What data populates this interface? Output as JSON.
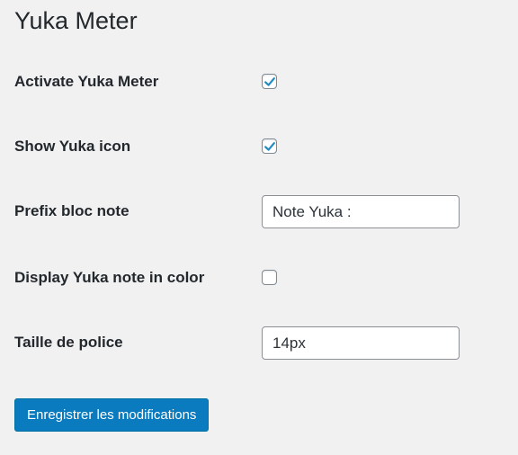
{
  "page": {
    "title": "Yuka Meter"
  },
  "settings": [
    {
      "label": "Activate Yuka Meter",
      "type": "checkbox",
      "checked": true
    },
    {
      "label": "Show Yuka icon",
      "type": "checkbox",
      "checked": true
    },
    {
      "label": "Prefix bloc note",
      "type": "text",
      "value": "Note Yuka :"
    },
    {
      "label": "Display Yuka note in color",
      "type": "checkbox",
      "checked": false
    },
    {
      "label": "Taille de police",
      "type": "text",
      "value": "14px"
    }
  ],
  "submit": {
    "label": "Enregistrer les modifications"
  },
  "colors": {
    "accent": "#0a7bbf",
    "check": "#1e8cbe",
    "background": "#f1f1f1"
  }
}
